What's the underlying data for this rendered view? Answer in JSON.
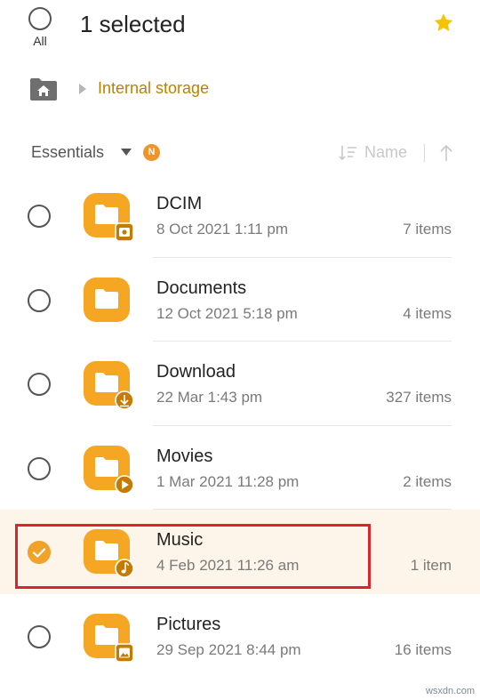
{
  "header": {
    "select_all_label": "All",
    "selection_title": "1 selected",
    "favorite_icon": "star-icon",
    "accent_color": "#f5c400"
  },
  "path": {
    "home_icon": "home-folder-icon",
    "crumb": "Internal storage",
    "crumb_color": "#b98300"
  },
  "sortbar": {
    "filter_label": "Essentials",
    "new_badge": "N",
    "sort_by_label": "Name",
    "sort_direction": "ascending"
  },
  "files": [
    {
      "name": "DCIM",
      "date": "8 Oct 2021 1:11 pm",
      "count": "7 items",
      "badge_icon": "camera-icon",
      "selected": false
    },
    {
      "name": "Documents",
      "date": "12 Oct 2021 5:18 pm",
      "count": "4 items",
      "badge_icon": "",
      "selected": false
    },
    {
      "name": "Download",
      "date": "22 Mar 1:43 pm",
      "count": "327 items",
      "badge_icon": "download-icon",
      "selected": false
    },
    {
      "name": "Movies",
      "date": "1 Mar 2021 11:28 pm",
      "count": "2 items",
      "badge_icon": "play-icon",
      "selected": false
    },
    {
      "name": "Music",
      "date": "4 Feb 2021 11:26 am",
      "count": "1 item",
      "badge_icon": "music-note-icon",
      "selected": true
    },
    {
      "name": "Pictures",
      "date": "29 Sep 2021 8:44 pm",
      "count": "16 items",
      "badge_icon": "image-icon",
      "selected": false
    }
  ],
  "folder_color": "#f5a623",
  "selection_highlight_color": "#d9262b",
  "watermark": "wsxdn.com"
}
